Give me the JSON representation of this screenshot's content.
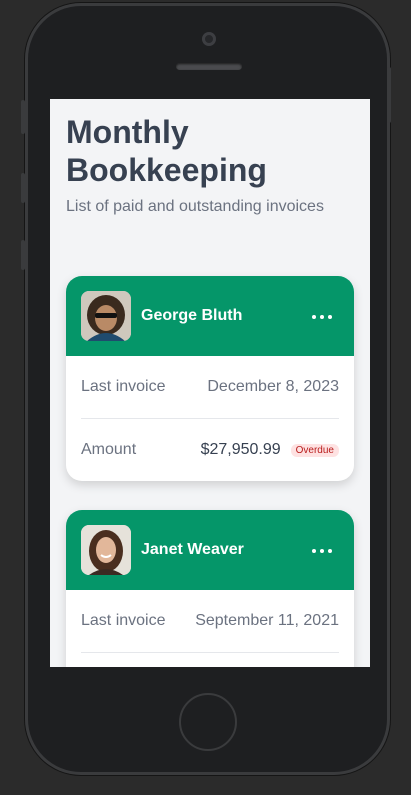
{
  "page": {
    "title": "Monthly Bookkeeping",
    "subtitle": "List of paid and outstanding invoices"
  },
  "clients": [
    {
      "name": "George Bluth",
      "avatar_icon": "person-avatar",
      "last_invoice_label": "Last invoice",
      "last_invoice_date": "December 8, 2023",
      "amount_label": "Amount",
      "amount": "$27,950.99",
      "status": "Overdue"
    },
    {
      "name": "Janet Weaver",
      "avatar_icon": "person-avatar",
      "last_invoice_label": "Last invoice",
      "last_invoice_date": "September 11, 2021"
    }
  ],
  "colors": {
    "header_green": "#059669",
    "title_text": "#374151",
    "muted_text": "#6b7280",
    "overdue_bg": "#fee2e2",
    "overdue_text": "#b91c1c"
  }
}
